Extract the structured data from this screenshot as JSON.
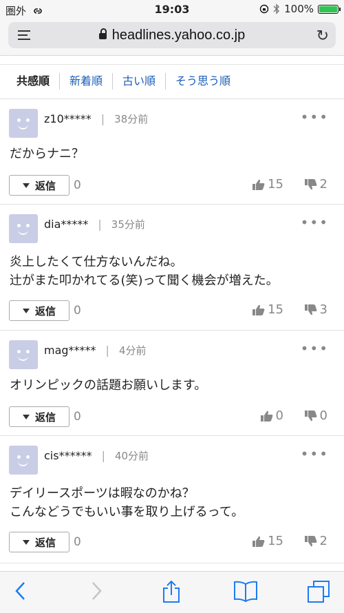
{
  "status": {
    "carrier": "圏外",
    "time": "19:03",
    "battery": "100%"
  },
  "browser": {
    "url": "headlines.yahoo.co.jp"
  },
  "sort": {
    "tabs": [
      "共感順",
      "新着順",
      "古い順",
      "そう思う順"
    ]
  },
  "comments": [
    {
      "user": "z10*****",
      "time": "38分前",
      "lines": [
        "だからナニ？"
      ],
      "reply_label": "返信",
      "reply_count": "0",
      "likes": "15",
      "dislikes": "2"
    },
    {
      "user": "dia*****",
      "time": "35分前",
      "lines": [
        "炎上したくて仕方ないんだね。",
        "辻がまた叩かれてる(笑)って聞く機会が増えた。"
      ],
      "reply_label": "返信",
      "reply_count": "0",
      "likes": "15",
      "dislikes": "3"
    },
    {
      "user": "mag*****",
      "time": "4分前",
      "lines": [
        "オリンピックの話題お願いします。"
      ],
      "reply_label": "返信",
      "reply_count": "0",
      "likes": "0",
      "dislikes": "0"
    },
    {
      "user": "cis******",
      "time": "40分前",
      "lines": [
        "デイリースポーツは暇なのかね？",
        "こんなどうでもいい事を取り上げるって。"
      ],
      "reply_label": "返信",
      "reply_count": "0",
      "likes": "15",
      "dislikes": "2"
    }
  ],
  "icons": {
    "more": "•••",
    "back": "chevron-left-icon",
    "forward": "chevron-right-icon",
    "share": "share-icon",
    "bookmarks": "book-icon",
    "tabs": "tabs-icon"
  },
  "colors": {
    "link": "#1a5cb8",
    "battery": "#31c453",
    "avatar": "#c9cde6"
  }
}
